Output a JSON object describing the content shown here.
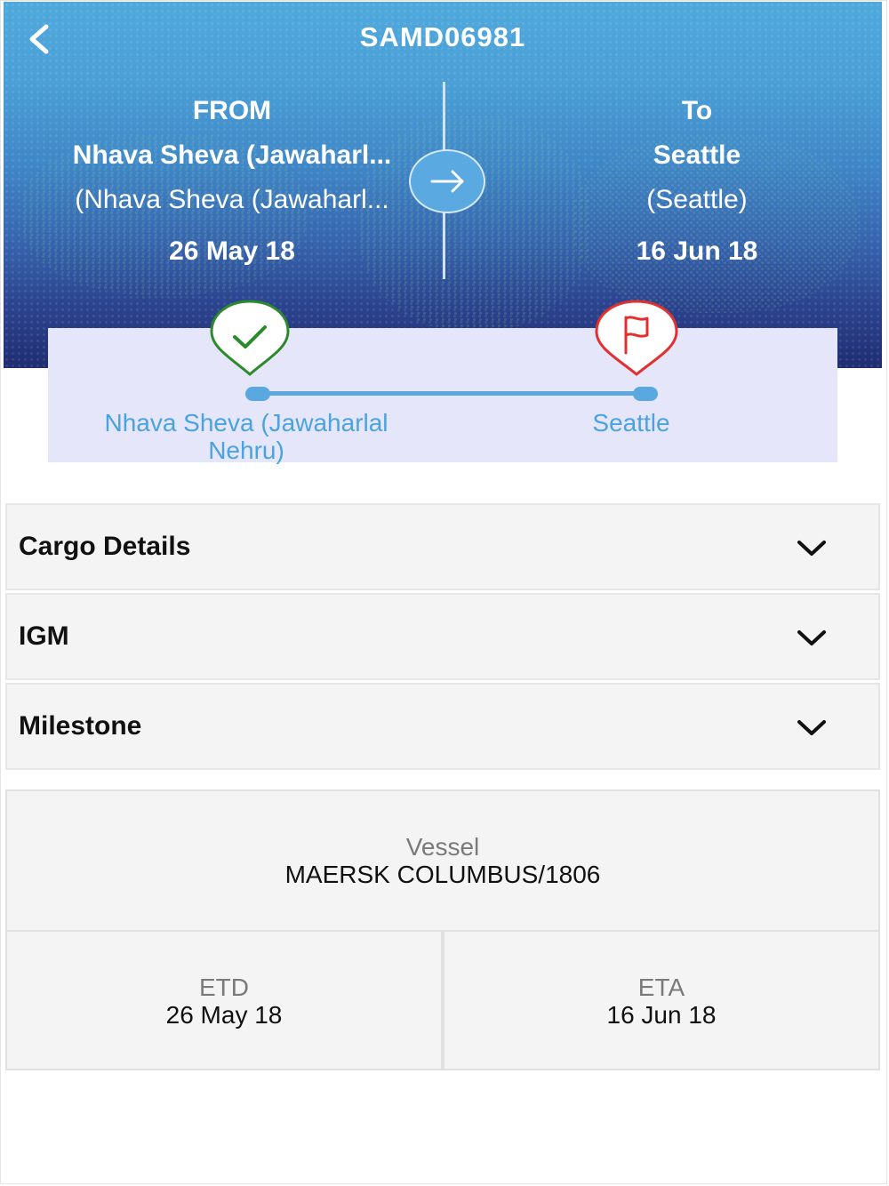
{
  "header": {
    "title": "SAMD06981",
    "from": {
      "label": "FROM",
      "city": "Nhava Sheva (Jawaharl...",
      "sub": "(Nhava Sheva (Jawaharl...",
      "date": "26 May 18"
    },
    "to": {
      "label": "To",
      "city": "Seattle",
      "sub": "(Seattle)",
      "date": "16 Jun 18"
    }
  },
  "route": {
    "origin_label": "Nhava Sheva (Jawaharlal Nehru)",
    "destination_label": "Seattle",
    "origin_color": "#2c8a2c",
    "destination_color": "#e23030",
    "line_color": "#59a8df"
  },
  "sections": [
    {
      "label": "Cargo Details"
    },
    {
      "label": "IGM"
    },
    {
      "label": "Milestone"
    }
  ],
  "vessel": {
    "label": "Vessel",
    "value": "MAERSK COLUMBUS/1806"
  },
  "etd": {
    "label": "ETD",
    "value": "26 May 18"
  },
  "eta": {
    "label": "ETA",
    "value": "16 Jun 18"
  },
  "icons": [
    "back-icon",
    "arrow-right-icon",
    "check-pin-icon",
    "flag-pin-icon",
    "chevron-down-icon"
  ]
}
